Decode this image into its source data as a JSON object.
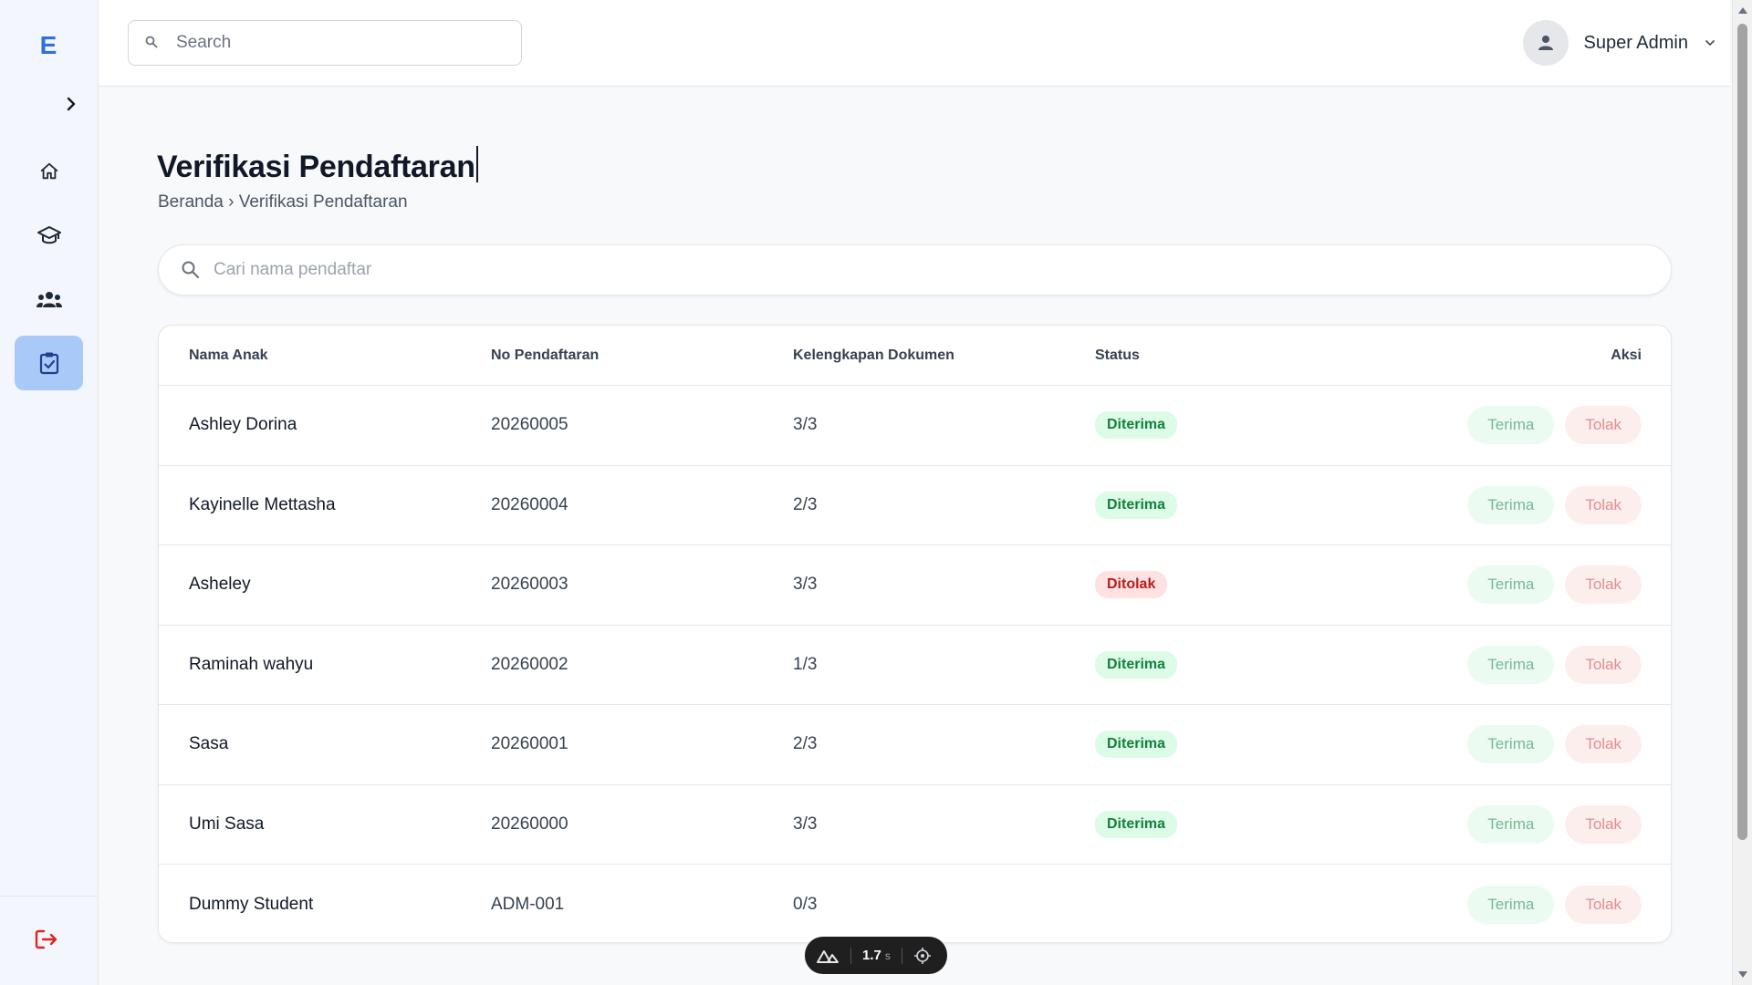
{
  "sidebar": {
    "logo": "E",
    "items": [
      {
        "name": "home",
        "icon": "home-icon"
      },
      {
        "name": "school",
        "icon": "graduation-cap-icon"
      },
      {
        "name": "users",
        "icon": "users-icon"
      },
      {
        "name": "verification",
        "icon": "clipboard-check-icon",
        "active": true
      }
    ],
    "logout_icon": "logout-icon"
  },
  "header": {
    "search_placeholder": "Search",
    "user_name": "Super Admin"
  },
  "page": {
    "title": "Verifikasi Pendaftaran",
    "breadcrumb": "Beranda › Verifikasi Pendaftaran",
    "search_placeholder": "Cari nama pendaftar"
  },
  "table": {
    "columns": [
      "Nama Anak",
      "No Pendaftaran",
      "Kelengkapan Dokumen",
      "Status",
      "Aksi"
    ],
    "accept_label": "Terima",
    "reject_label": "Tolak",
    "rows": [
      {
        "name": "Ashley Dorina",
        "number": "20260005",
        "docs": "3/3",
        "status": "Diterima"
      },
      {
        "name": "Kayinelle Mettasha",
        "number": "20260004",
        "docs": "2/3",
        "status": "Diterima"
      },
      {
        "name": "Asheley",
        "number": "20260003",
        "docs": "3/3",
        "status": "Ditolak"
      },
      {
        "name": "Raminah wahyu",
        "number": "20260002",
        "docs": "1/3",
        "status": "Diterima"
      },
      {
        "name": "Sasa",
        "number": "20260001",
        "docs": "2/3",
        "status": "Diterima"
      },
      {
        "name": "Umi Sasa",
        "number": "20260000",
        "docs": "3/3",
        "status": "Diterima"
      },
      {
        "name": "Dummy Student",
        "number": "ADM-001",
        "docs": "0/3",
        "status": ""
      }
    ]
  },
  "devtools": {
    "time": "1.7",
    "unit": "s"
  },
  "colors": {
    "accent": "#2f6fe0",
    "active_nav": "#a9caf9",
    "accepted": "#15803d",
    "rejected": "#b91c1c"
  }
}
